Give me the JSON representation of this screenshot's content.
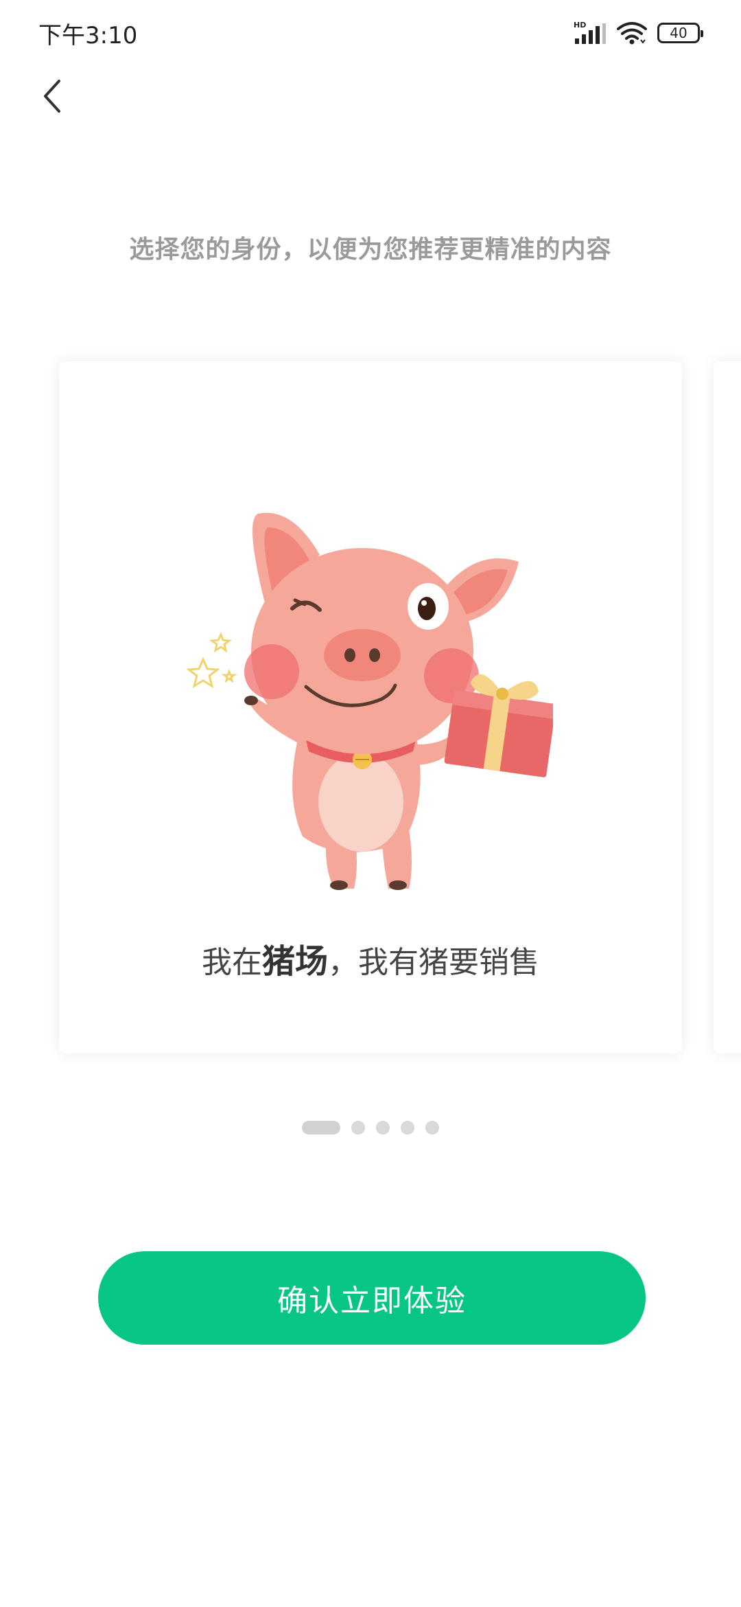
{
  "status_bar": {
    "time": "下午3:10",
    "network_label": "HD",
    "battery_level": "40",
    "icons": [
      "signal-icon",
      "wifi-icon",
      "battery-icon"
    ]
  },
  "nav": {
    "back_icon": "chevron-left-icon"
  },
  "header": {
    "subtitle": "选择您的身份，以便为您推荐更精准的内容"
  },
  "carousel": {
    "active_index": 0,
    "total": 5,
    "cards": [
      {
        "caption_prefix": "我在",
        "caption_emphasis": "猪场",
        "caption_suffix": "，我有猪要销售",
        "illustration": "pig-with-gift-illustration"
      }
    ]
  },
  "actions": {
    "confirm_label": "确认立即体验"
  },
  "colors": {
    "accent": "#07c584",
    "subtitle_text": "#9a9a9a",
    "dot_inactive": "#d9d9d9"
  }
}
